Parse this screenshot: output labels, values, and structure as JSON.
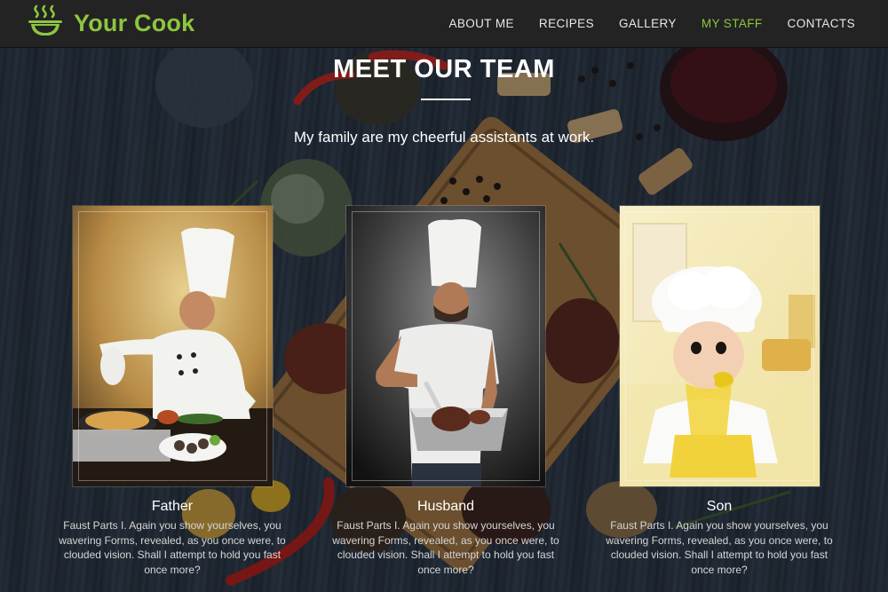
{
  "header": {
    "brand": "Your Cook",
    "logo_icon": "steaming-bowl-icon",
    "accent_color": "#8cc63f",
    "nav": [
      {
        "label": "ABOUT ME",
        "active": false
      },
      {
        "label": "RECIPES",
        "active": false
      },
      {
        "label": "GALLERY",
        "active": false
      },
      {
        "label": "MY STAFF",
        "active": true
      },
      {
        "label": "CONTACTS",
        "active": false
      }
    ]
  },
  "section": {
    "title": "MEET OUR TEAM",
    "subtitle": "My family are my cheerful assistants at work."
  },
  "team": [
    {
      "name": "Father",
      "bio": "Faust Parts I. Again you show yourselves, you wavering Forms, revealed, as you once were, to clouded vision. Shall I attempt to hold you fast once more?",
      "photo": "older-chef-pouring-sauce-photo"
    },
    {
      "name": "Husband",
      "bio": "Faust Parts I. Again you show yourselves, you wavering Forms, revealed, as you once were, to clouded vision. Shall I attempt to hold you fast once more?",
      "photo": "chef-slicing-roast-photo"
    },
    {
      "name": "Son",
      "bio": "Faust Parts I. Again you show yourselves, you wavering Forms, revealed, as you once were, to clouded vision. Shall I attempt to hold you fast once more?",
      "photo": "baby-chef-eating-pepper-photo"
    }
  ]
}
